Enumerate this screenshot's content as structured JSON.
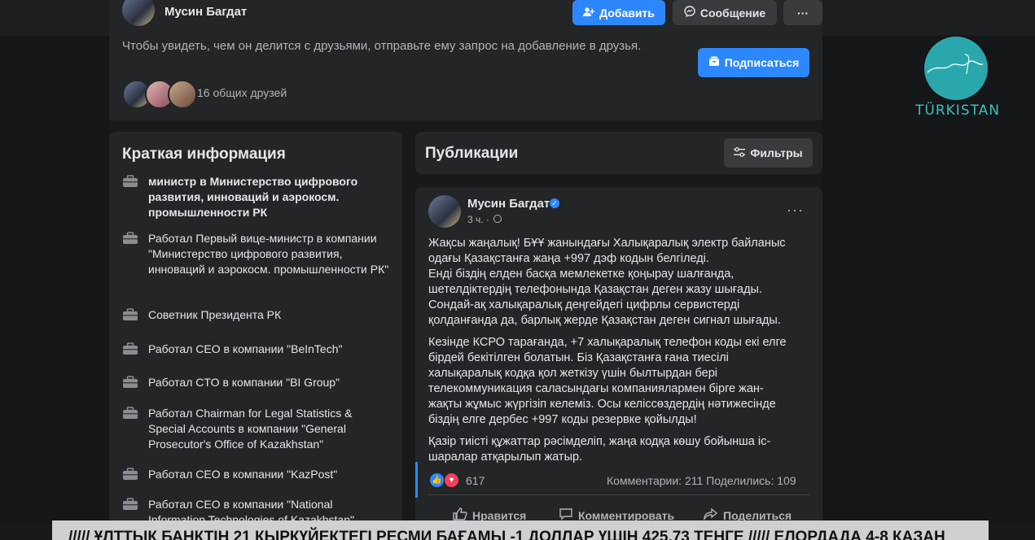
{
  "profile": {
    "name": "Мусин Багдат",
    "add_button": "Добавить",
    "message_button": "Сообщение",
    "more_button": "···",
    "notice": "Чтобы увидеть, чем он делится с друзьями, отправьте ему запрос на добавление в друзья.",
    "subscribe_button": "Подписаться",
    "mutual_friends": "16 общих друзей"
  },
  "intro": {
    "title": "Краткая информация",
    "items": [
      "министр в Министерство цифрового развития, инноваций и аэрокосм. промышленности РК",
      "Работал Первый вице-министр в компании \"Министерство цифрового развития, инноваций и аэрокосм. промышленности РК\"",
      "Советник Президента РК",
      "Работал CEO в компании \"BeInTech\"",
      "Работал CTO в компании \"BI Group\"",
      "Работал Chairman for Legal Statistics & Special Accounts в компании \"General Prosecutor's Office of Kazakhstan\"",
      "Работал CEO в компании \"KazPost\"",
      "Работал CEO в компании \"National Information Technologies of Kazakhstan\""
    ]
  },
  "publications": {
    "title": "Публикации",
    "filters_button": "Фильтры"
  },
  "post": {
    "author": "Мусин Багдат",
    "time": "3 ч. ·",
    "more": "···",
    "paragraph1": "Жақсы жаңалық!  БҰҰ жанындағы Халықаралық электр байланыс\nодағы Қазақстанға жаңа +997 дэф кодын белгіледі.\nЕнді біздің елден басқа мемлекетке қоңырау шалғанда,\nшетелдіктердің телефонында Қазақстан деген жазу шығады.\nСондай-ақ халықаралық деңгейдегі цифрлы сервистерді\nқолданғанда да, барлық жерде Қазақстан деген сигнал шығады.",
    "paragraph2": "Кезінде КСРО тарағанда, +7 халықаралық телефон коды екі елге\nбірдей бекітілген болатын. Біз Қазақстанға ғана тиесілі\nхалықаралық кодқа қол жеткізу үшін былтырдан бері\nтелекоммуникация саласындағы компаниялармен  бірге жан-\nжақты жұмыс жүргізіп келеміз. Осы келіссөздердің нәтижесінде\nбіздің елге дербес +997 коды резервке қойылды!",
    "paragraph3": "Қазір тиісті құжаттар рәсімделіп, жаңа кодқа көшу бойынша іс-\nшаралар атқарылып жатыр.",
    "reactions": "617",
    "stats": "Комментарии: 211  Поделились: 109",
    "like": "Нравится",
    "comment": "Комментировать",
    "share": "Поделиться"
  },
  "logo": {
    "text": "TÜRKISTAN"
  },
  "ticker": {
    "text": "/////  ҰЛТТЫҚ БАНКТІҢ 21 ҚЫРКҮЙЕКТЕГІ РЕСМИ БАҒАМЫ  -1 ДОЛЛАР ҮШІН 425,73 ТЕҢГЕ   /////  ЕЛОРДАДА 4-8 ҚАЗАН"
  },
  "colors": {
    "accent": "#2d88ff",
    "card": "#242526",
    "page": "#18191a",
    "logo": "#2aa7ad"
  }
}
